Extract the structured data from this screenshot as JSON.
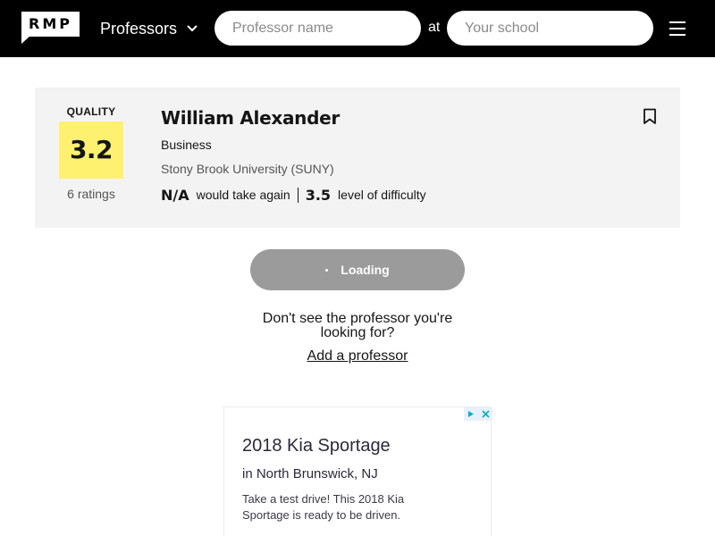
{
  "header": {
    "logo_text": "RMP",
    "dropdown_label": "Professors",
    "professor_placeholder": "Professor name",
    "at_label": "at",
    "school_placeholder": "Your school",
    "icons": {
      "dropdown": "chevron-down-icon",
      "menu": "hamburger-menu-icon"
    }
  },
  "card": {
    "quality_label": "QUALITY",
    "quality_value": "3.2",
    "ratings": "6 ratings",
    "name": "William Alexander",
    "department": "Business",
    "school": "Stony Brook University (SUNY)",
    "would_take_again_value": "N/A",
    "would_take_again_label": "would take again",
    "difficulty_value": "3.5",
    "difficulty_label": "level of difficulty",
    "bookmark_icon": "bookmark-icon",
    "quality_color": "#fff170"
  },
  "loading_button": {
    "label": "Loading"
  },
  "not_found": {
    "prompt": "Don't see the professor you're looking for?",
    "link": "Add a professor"
  },
  "ad": {
    "title": "2018 Kia Sportage",
    "subtitle": "in North Brunswick, NJ",
    "body": "Take a test drive! This 2018 Kia Sportage is ready to be driven.",
    "icons": {
      "adchoices": "play-triangle-icon",
      "close": "close-icon"
    }
  },
  "colors": {
    "header_bg": "#000000",
    "card_bg": "#f3f3f3",
    "button_bg": "#9b9b9b"
  }
}
